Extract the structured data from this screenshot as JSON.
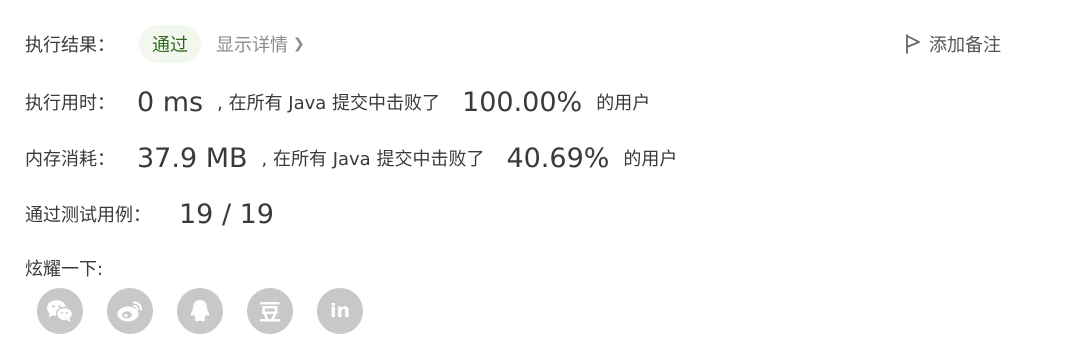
{
  "result": {
    "label": "执行结果：",
    "status": "通过",
    "details_link": "显示详情",
    "add_note": "添加备注"
  },
  "runtime": {
    "label": "执行用时：",
    "value": "0 ms",
    "prefix": ", 在所有 Java 提交中击败了",
    "percent": "100.00%",
    "suffix": "的用户"
  },
  "memory": {
    "label": "内存消耗：",
    "value": "37.9 MB",
    "prefix": ", 在所有 Java 提交中击败了",
    "percent": "40.69%",
    "suffix": "的用户"
  },
  "tests": {
    "label": "通过测试用例：",
    "value": "19 / 19"
  },
  "share": {
    "label": "炫耀一下:",
    "buttons": [
      {
        "icon": "wechat-icon"
      },
      {
        "icon": "weibo-icon"
      },
      {
        "icon": "qq-icon"
      },
      {
        "icon": "douban-icon",
        "glyph": "豆"
      },
      {
        "icon": "linkedin-icon",
        "glyph": "in"
      }
    ]
  },
  "colors": {
    "status_bg": "#f3f8ef",
    "status_text": "#2d6a1a",
    "share_icon_bg": "#c8c8c8",
    "muted_text": "#8c8c8c"
  }
}
